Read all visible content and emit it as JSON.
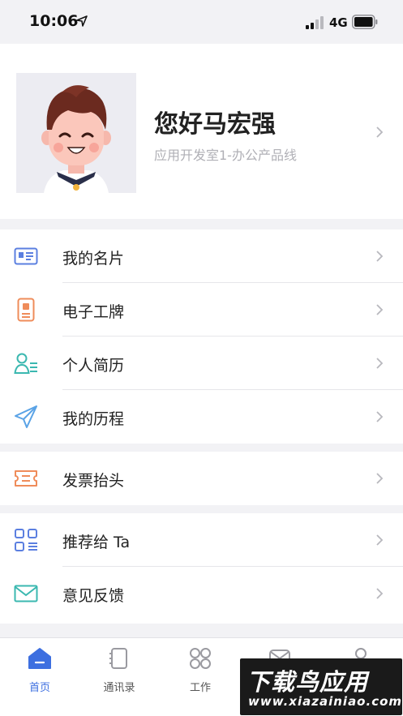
{
  "status_bar": {
    "time": "10:06",
    "network": "4G"
  },
  "profile": {
    "name": "您好马宏强",
    "department": "应用开发室1-办公产品线"
  },
  "menu_groups": [
    {
      "items": [
        {
          "label": "我的名片",
          "icon": "business-card-icon",
          "color": "#5b7fe0"
        },
        {
          "label": "电子工牌",
          "icon": "badge-icon",
          "color": "#ef8c5a"
        },
        {
          "label": "个人简历",
          "icon": "resume-icon",
          "color": "#3bb8b0"
        },
        {
          "label": "我的历程",
          "icon": "paper-plane-icon",
          "color": "#5aa3e6"
        }
      ]
    },
    {
      "items": [
        {
          "label": "发票抬头",
          "icon": "ticket-icon",
          "color": "#ef8c5a"
        }
      ]
    },
    {
      "items": [
        {
          "label": "推荐给 Ta",
          "icon": "grid-list-icon",
          "color": "#5b7fe0"
        },
        {
          "label": "意见反馈",
          "icon": "mail-icon",
          "color": "#3bb8b0"
        }
      ]
    }
  ],
  "tab_bar": {
    "tabs": [
      {
        "label": "首页",
        "icon": "home-icon",
        "active": true
      },
      {
        "label": "通讯录",
        "icon": "contacts-icon",
        "active": false
      },
      {
        "label": "工作",
        "icon": "apps-grid-icon",
        "active": false
      },
      {
        "label": "",
        "icon": "message-icon",
        "active": false
      },
      {
        "label": "",
        "icon": "user-icon",
        "active": false
      }
    ]
  },
  "watermark": {
    "title": "下载鸟应用",
    "url": "www.xiazainiao.com"
  },
  "colors": {
    "accent": "#3d6fe0",
    "background": "#f2f2f5",
    "chevron": "#b8b8be"
  }
}
